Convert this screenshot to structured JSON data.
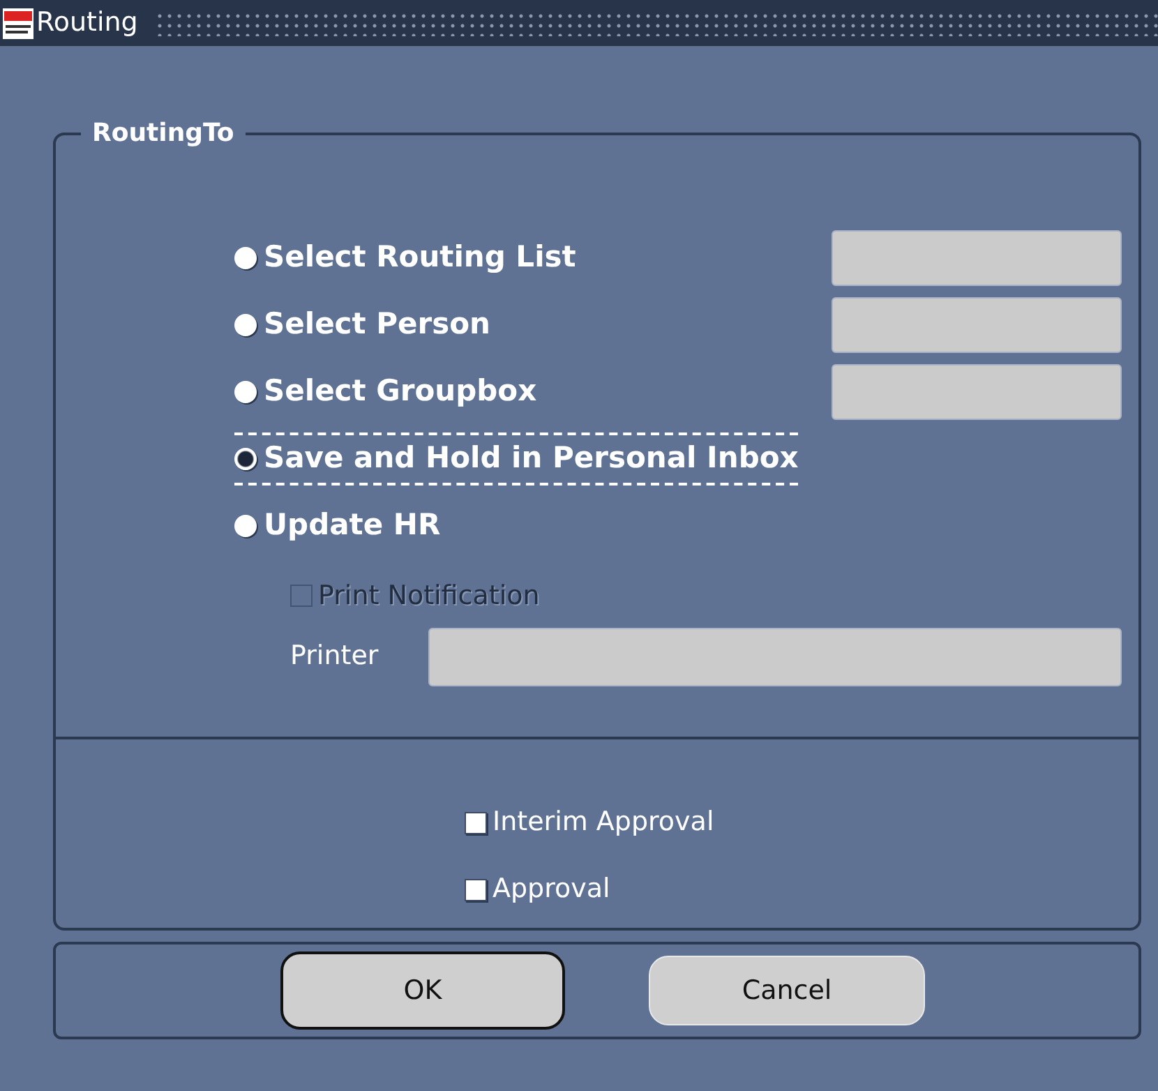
{
  "window": {
    "title": "Routing"
  },
  "group": {
    "title": "RoutingTo"
  },
  "options": [
    {
      "label": "Select Routing List",
      "selected": false,
      "has_field": true
    },
    {
      "label": "Select Person",
      "selected": false,
      "has_field": true
    },
    {
      "label": "Select Groupbox",
      "selected": false,
      "has_field": true
    },
    {
      "label": "Save and Hold in Personal Inbox",
      "selected": true,
      "has_field": false
    },
    {
      "label": "Update HR",
      "selected": false,
      "has_field": false
    }
  ],
  "print_notification": {
    "label": "Print Notification",
    "checked": false,
    "disabled": true
  },
  "printer": {
    "label": "Printer"
  },
  "approvals": [
    {
      "label": "Interim Approval",
      "checked": false
    },
    {
      "label": "Approval",
      "checked": false
    }
  ],
  "buttons": [
    {
      "label": "OK",
      "default": true
    },
    {
      "label": "Cancel",
      "default": false
    }
  ]
}
